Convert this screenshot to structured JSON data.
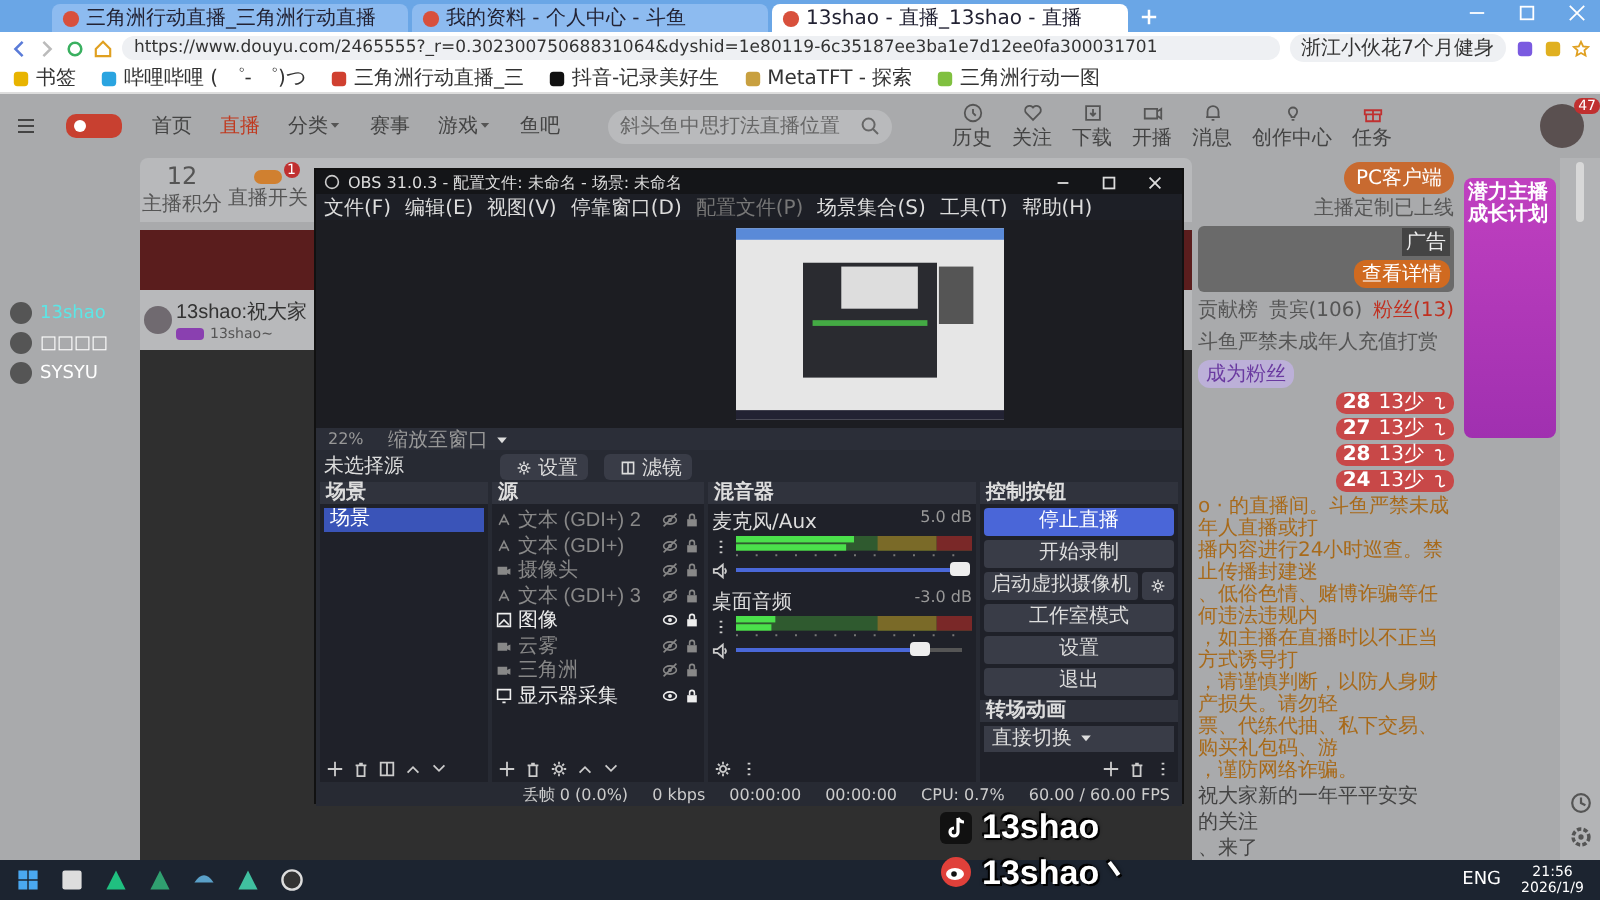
{
  "browser": {
    "tabs": [
      {
        "title": "三角洲行动直播_三角洲行动直播",
        "selected": false
      },
      {
        "title": "我的资料 - 个人中心 - 斗鱼",
        "selected": false
      },
      {
        "title": "13shao - 直播_13shao - 直播",
        "selected": true
      }
    ],
    "url": "https://www.douyu.com/2465555?_r=0.30230075068831064&dyshid=1e80119-6c35187ee3ba1e7d12ee0fa300031701",
    "news": "浙江小伙花7个月健身",
    "bookmarks": [
      {
        "label": "书签",
        "kind": "star"
      },
      {
        "label": "哔哩哔哩 ( ゜- ゜)つ",
        "kind": "tv"
      },
      {
        "label": "三角洲行动直播_三",
        "kind": "fish"
      },
      {
        "label": "抖音-记录美好生",
        "kind": "note"
      },
      {
        "label": "MetaTFT - 探索",
        "kind": "coin"
      },
      {
        "label": "三角洲行动一图",
        "kind": "flag"
      }
    ]
  },
  "site": {
    "nav": [
      {
        "label": "首页",
        "selected": false,
        "dropdown": false
      },
      {
        "label": "直播",
        "selected": true,
        "dropdown": false
      },
      {
        "label": "分类",
        "selected": false,
        "dropdown": true
      },
      {
        "label": "赛事",
        "selected": false,
        "dropdown": false
      },
      {
        "label": "游戏",
        "selected": false,
        "dropdown": true
      },
      {
        "label": "鱼吧",
        "selected": false,
        "dropdown": false
      }
    ],
    "search": {
      "placeholder": "斜头鱼中思打法直播位置"
    },
    "header_links": [
      {
        "label": "历史",
        "kind": "history"
      },
      {
        "label": "关注",
        "kind": "heart"
      },
      {
        "label": "下载",
        "kind": "download"
      },
      {
        "label": "开播",
        "kind": "camera"
      },
      {
        "label": "消息",
        "kind": "bell"
      },
      {
        "label": "创作中心",
        "kind": "bulb"
      },
      {
        "label": "任务",
        "kind": "gift"
      }
    ],
    "avatar_badge": "47",
    "friends": [
      {
        "name": "13shao",
        "selected": true
      },
      {
        "name": "□□□□",
        "selected": false
      },
      {
        "name": "SYSYU",
        "selected": false
      }
    ],
    "points": {
      "value": "12",
      "label": "主播积分"
    },
    "live_switch": {
      "label": "直播开关",
      "badge": "1",
      "on": true
    },
    "streamer": {
      "title": "13shao:祝大家",
      "name": "13shao~"
    },
    "pc_client": {
      "button": "PC客户端",
      "note": "主播定制已上线"
    },
    "ad": {
      "label": "广告",
      "button": "查看详情"
    },
    "rank_tabs": [
      {
        "label": "贡献榜",
        "selected": false
      },
      {
        "label": "贵宾(106)",
        "selected": false
      },
      {
        "label": "粉丝(13)",
        "selected": true
      }
    ],
    "notice": "斗鱼严禁未成年人充值打赏",
    "join_fans": "成为粉丝",
    "fans": [
      {
        "rank": "28",
        "name": "13少"
      },
      {
        "rank": "27",
        "name": "13少"
      },
      {
        "rank": "28",
        "name": "13少"
      },
      {
        "rank": "24",
        "name": "13少"
      }
    ],
    "rules_text": [
      "o · 的直播间。斗鱼严禁未成年人直播或打",
      "播内容进行24小时巡查。禁止传播封建迷",
      "、低俗色情、赌博诈骗等任何违法违规内",
      "，如主播在直播时以不正当方式诱导打",
      "，请谨慎判断，以防人身财产损失。请勿轻",
      "票、代练代抽、私下交易、购买礼包码、游",
      "，谨防网络诈骗。"
    ],
    "chat": [
      "祝大家新的一年平平安安",
      "的关注",
      "、来了"
    ],
    "promo": "潜力主播成长计划"
  },
  "obs": {
    "title": "OBS 31.0.3 - 配置文件: 未命名 - 场景: 未命名",
    "menu": [
      {
        "label": "文件(F)",
        "disabled": false
      },
      {
        "label": "编辑(E)",
        "disabled": false
      },
      {
        "label": "视图(V)",
        "disabled": false
      },
      {
        "label": "停靠窗口(D)",
        "disabled": false
      },
      {
        "label": "配置文件(P)",
        "disabled": true
      },
      {
        "label": "场景集合(S)",
        "disabled": false
      },
      {
        "label": "工具(T)",
        "disabled": false
      },
      {
        "label": "帮助(H)",
        "disabled": false
      }
    ],
    "zoom": "22%",
    "zoom_mode": "缩放至窗口",
    "no_source": "未选择源",
    "props_button": "设置",
    "filters_button": "滤镜",
    "docks": {
      "scenes": "场景",
      "sources": "源",
      "mixer": "混音器",
      "controls": "控制按钮",
      "transitions": "转场动画"
    },
    "scenes": [
      {
        "name": "场景",
        "selected": true
      }
    ],
    "sources": [
      {
        "name": "文本 (GDI+) 2",
        "kind": "text",
        "visible": false
      },
      {
        "name": "文本 (GDI+)",
        "kind": "text",
        "visible": false
      },
      {
        "name": "摄像头",
        "kind": "camera",
        "visible": false
      },
      {
        "name": "文本 (GDI+) 3",
        "kind": "text",
        "visible": false
      },
      {
        "name": "图像",
        "kind": "image",
        "visible": true
      },
      {
        "name": "云雾",
        "kind": "camera",
        "visible": false
      },
      {
        "name": "三角洲",
        "kind": "camera",
        "visible": false
      },
      {
        "name": "显示器采集",
        "kind": "display",
        "visible": true
      }
    ],
    "mixer": [
      {
        "name": "麦克风/Aux",
        "reading": "5.0 dB",
        "level": 1.0
      },
      {
        "name": "桌面音频",
        "reading": "-3.0 dB",
        "level": 0.82
      }
    ],
    "controls": [
      {
        "label": "停止直播",
        "active": true,
        "gear": false
      },
      {
        "label": "开始录制",
        "active": false,
        "gear": false
      },
      {
        "label": "启动虚拟摄像机",
        "active": false,
        "gear": true
      },
      {
        "label": "工作室模式",
        "active": false,
        "gear": false
      },
      {
        "label": "设置",
        "active": false,
        "gear": false
      },
      {
        "label": "退出",
        "active": false,
        "gear": false
      }
    ],
    "transition": "直接切换",
    "status": {
      "dropped": "丢帧 0 (0.0%)",
      "bitrate": "0 kbps",
      "stream_time": "00:00:00",
      "record_time": "00:00:00",
      "cpu": "CPU: 0.7%",
      "fps": "60.00 / 60.00 FPS"
    }
  },
  "overlay": [
    {
      "kind": "tiktok",
      "text": "13shao"
    },
    {
      "kind": "weibo",
      "text": "13shao丶"
    }
  ],
  "taskbar": {
    "language": "ENG",
    "time": "21:56",
    "date": "2026/1/9"
  }
}
